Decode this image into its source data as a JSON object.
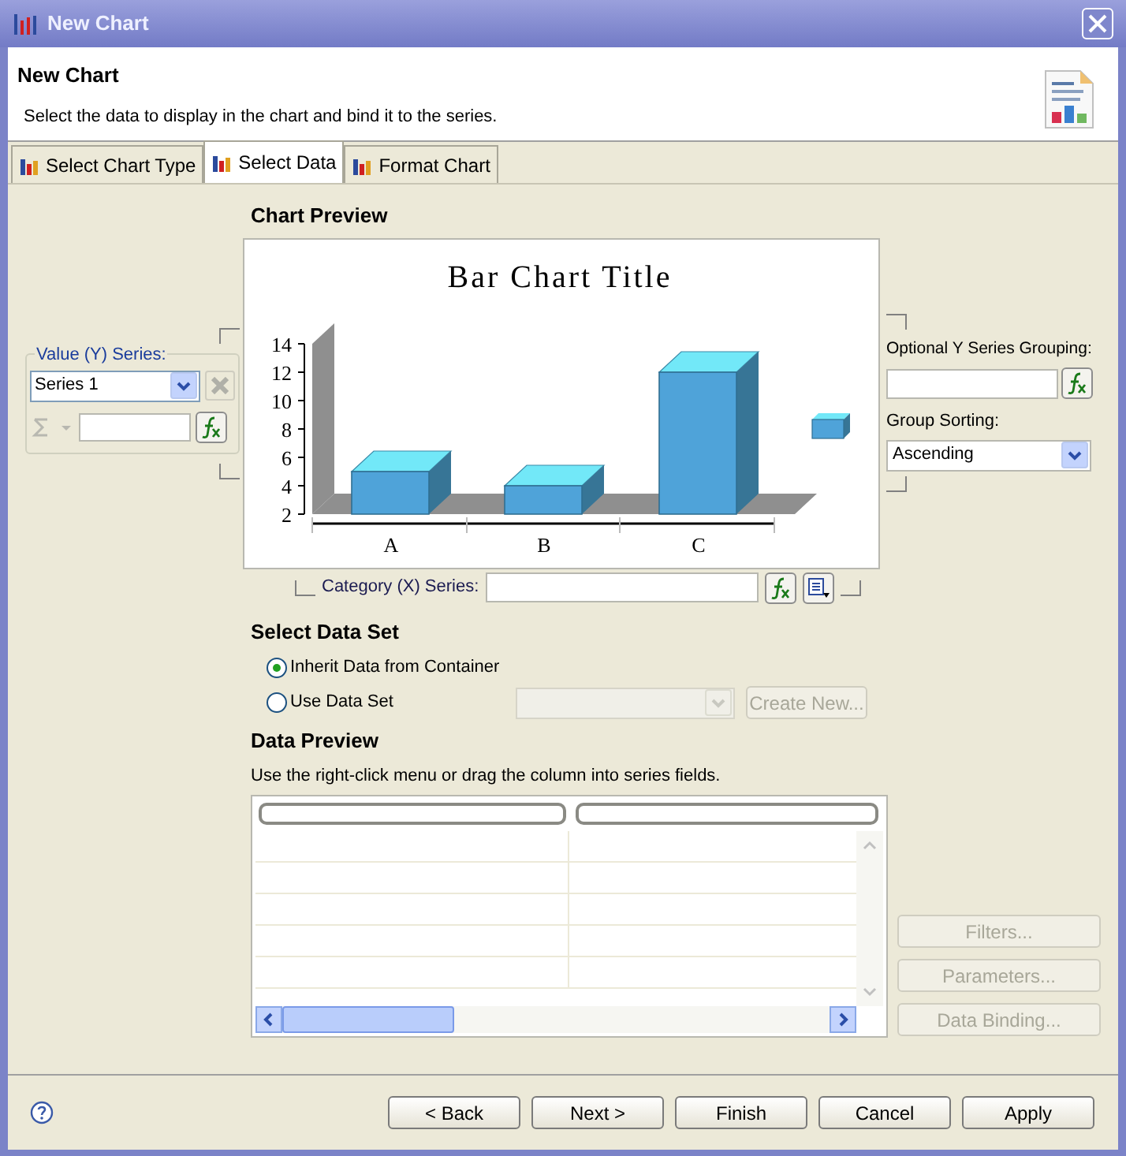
{
  "window": {
    "title": "New Chart"
  },
  "header": {
    "title": "New Chart",
    "description": "Select the data to display in the chart and bind it to the series."
  },
  "tabs": [
    {
      "label": "Select Chart Type",
      "selected": false
    },
    {
      "label": "Select Data",
      "selected": true
    },
    {
      "label": "Format Chart",
      "selected": false
    }
  ],
  "chart_preview": {
    "heading": "Chart Preview",
    "chart_data": {
      "type": "bar",
      "title": "Bar Chart Title",
      "categories": [
        "A",
        "B",
        "C"
      ],
      "series": [
        {
          "color": "#4fa3d9",
          "values": [
            5,
            4,
            12
          ]
        }
      ],
      "ylim": [
        2,
        14
      ],
      "yticks": [
        2,
        4,
        6,
        8,
        10,
        12,
        14
      ]
    }
  },
  "value_series": {
    "label": "Value (Y) Series:",
    "selected": "Series 1"
  },
  "category_series": {
    "label": "Category (X) Series:"
  },
  "grouping": {
    "label": "Optional Y Series Grouping:",
    "sorting_label": "Group Sorting:",
    "sorting": "Ascending"
  },
  "data_set": {
    "heading": "Select Data Set",
    "options": [
      {
        "label": "Inherit Data from Container",
        "selected": true
      },
      {
        "label": "Use Data Set",
        "selected": false
      }
    ],
    "create_button": {
      "label": "Create New...",
      "disabled": true
    }
  },
  "data_preview": {
    "heading": "Data Preview",
    "hint": "Use the right-click menu or drag the column into series fields."
  },
  "side_buttons": [
    {
      "label": "Filters...",
      "disabled": true
    },
    {
      "label": "Parameters...",
      "disabled": true
    },
    {
      "label": "Data Binding...",
      "disabled": true
    }
  ],
  "footer_buttons": [
    {
      "label": "< Back"
    },
    {
      "label": "Next >"
    },
    {
      "label": "Finish"
    },
    {
      "label": "Cancel"
    },
    {
      "label": "Apply"
    }
  ]
}
